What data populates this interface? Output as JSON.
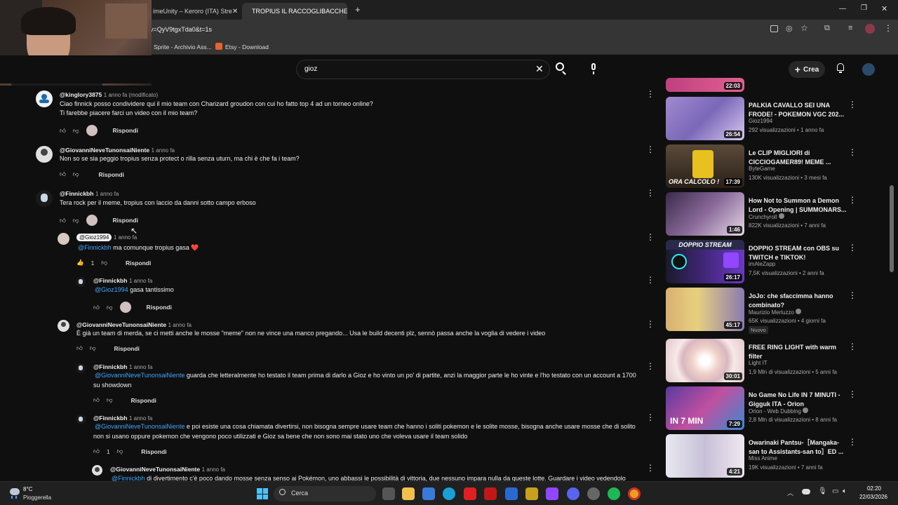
{
  "browser": {
    "tabs": [
      {
        "title": "imeUnity – Keroro (ITA) Stre"
      },
      {
        "title": "TROPIUS IL RACCOGLIBACCHE"
      }
    ],
    "new_tab": "+",
    "url": "v=QyV9tgxTda0&t=1s",
    "bookmarks": [
      {
        "label": "Sprite - Archivio Ass..."
      },
      {
        "label": "Etsy - Download"
      }
    ]
  },
  "header": {
    "search_query": "gioz",
    "create_label": "Crea"
  },
  "comments": [
    {
      "user": "@kinglory3875",
      "time": "1 anno fa (modificato)",
      "text1": "Ciao finnick posso condividere qui il mio team con Charizard groudon con cui ho fatto top 4 ad un torneo online?",
      "text2": "Ti farebbe piacere farci un video con il mio team?",
      "reply": "Rispondi"
    },
    {
      "user": "@GiovanniNeveTunonsaiNiente",
      "time": "1 anno fa",
      "text1": "Non so se sia peggio tropius senza protect o rilla senza uturn, ma chi è che fa i team?",
      "reply": "Rispondi"
    },
    {
      "user": "@Finnickbh",
      "time": "1 anno fa",
      "text1": "Tera rock per il meme, tropius con laccio da danni sotto campo erboso",
      "reply": "Rispondi"
    },
    {
      "user": "@Gioz1994",
      "time": "1 anno fa",
      "mention": "@Finnickbh",
      "text1": "ma comunque tropius gasa ❤️",
      "likes": "1",
      "reply": "Rispondi"
    },
    {
      "user": "@Finnickbh",
      "time": "1 anno fa",
      "mention": "@Gioz1994",
      "text1": "gasa tantissimo",
      "reply": "Rispondi"
    },
    {
      "user": "@GiovanniNeveTunonsaiNiente",
      "time": "1 anno fa",
      "text1": "È già un team di merda, se ci metti anche le mosse \"meme\" non ne vince una manco pregando... Usa le build decenti plz, sennò passa anche la voglia di vedere i video",
      "reply": "Rispondi"
    },
    {
      "user": "@Finnickbh",
      "time": "1 anno fa",
      "mention": "@GiovanniNeveTunonsaiNiente",
      "text1": "guarda che letteralmente ho testato il team prima di darlo a Gioz e ho vinto un po' di partite, anzi la maggior parte le ho vinte e l'ho testato con un account a 1700",
      "text2": "su showdown",
      "reply": "Rispondi"
    },
    {
      "user": "@Finnickbh",
      "time": "1 anno fa",
      "mention": "@GiovanniNeveTunonsaiNiente",
      "text1": "e poi esiste una cosa chiamata divertirsi, non bisogna sempre usare team che hanno i soliti pokemon e le solite mosse, bisogna anche usare mosse che di solito",
      "text2": "non si usano oppure pokemon che vengono poco utilizzati e Gioz sa bene che non sono mai stato uno che voleva usare il team solido",
      "likes": "1",
      "reply": "Rispondi"
    },
    {
      "user": "@GiovanniNeveTunonsaiNiente",
      "time": "1 anno fa",
      "mention": "@Finnickbh",
      "text1": "di divertimento c'è poco dando mosse senza senso ai Pokémon, uno abbassi le possibilità di vittoria, due nessuno impara nulla da queste lotte. Guardare i video vedendolo"
    }
  ],
  "sidebar": {
    "videos": [
      {
        "duration": "22:03",
        "title": "",
        "channel": "",
        "meta": ""
      },
      {
        "duration": "26:54",
        "title": "PALKIA CAVALLO SEI UNA FRODE! - POKEMON VGC 202...",
        "channel": "Gioz1994",
        "meta": "292 visualizzazioni • 1 anno fa",
        "thumb_color": "#7a68b8"
      },
      {
        "duration": "17:39",
        "title": "Le CLIP MIGLIORI di CICCIOGAMER89! MEME ...",
        "channel": "ByteGame",
        "meta": "130K visualizzazioni • 3 mesi fa",
        "thumb_color": "#4a3d30",
        "thumb_text": "ORA CALCOLO !"
      },
      {
        "duration": "1:46",
        "title": "How Not to Summon a Demon Lord - Opening | SUMMONARS...",
        "channel": "Crunchyroll",
        "meta": "822K visualizzazioni • 7 anni fa",
        "thumb_color": "#6e5a8a"
      },
      {
        "duration": "26:17",
        "title": "DOPPIO STREAM con OBS su TWITCH e TIKTOK!",
        "channel": "imAleZapp",
        "meta": "7,5K visualizzazioni • 2 anni fa",
        "thumb_color": "#3a2a6a",
        "thumb_text": "DOPPIO STREAM"
      },
      {
        "duration": "45:17",
        "title": "JoJo: che sfaccimma hanno combinato?",
        "channel": "Maurizio Merluzzo",
        "meta": "65K visualizzazioni • 4 giorni fa",
        "badge": "Nuovo",
        "thumb_color": "#b9a25a"
      },
      {
        "duration": "30:01",
        "title": "FREE RING LIGHT with warm filter",
        "channel": "Light IT",
        "meta": "1,9 Mln di visualizzazioni • 5 anni fa",
        "thumb_color": "#f0d8d0"
      },
      {
        "duration": "7:29",
        "title": "No Game No Life IN 7 MINUTI - Gigguk ITA - Orion",
        "channel": "Orion - Web Dubbing",
        "meta": "2,8 Mln di visualizzazioni • 8 anni fa",
        "thumb_color": "#8a4aa0",
        "thumb_text": "IN 7 MIN"
      },
      {
        "duration": "4:21",
        "title": "Owarinaki Pantsu-［Mangaka-san to Assistants-san to］ED ...",
        "channel": "Miss Anime",
        "meta": "19K visualizzazioni • 7 anni fa",
        "thumb_color": "#d8d8e0"
      }
    ]
  },
  "taskbar": {
    "weather_temp": "8°C",
    "weather_desc": "Pioggerella",
    "search_label": "Cerca",
    "time": "02:20",
    "date": "22/03/2026"
  }
}
